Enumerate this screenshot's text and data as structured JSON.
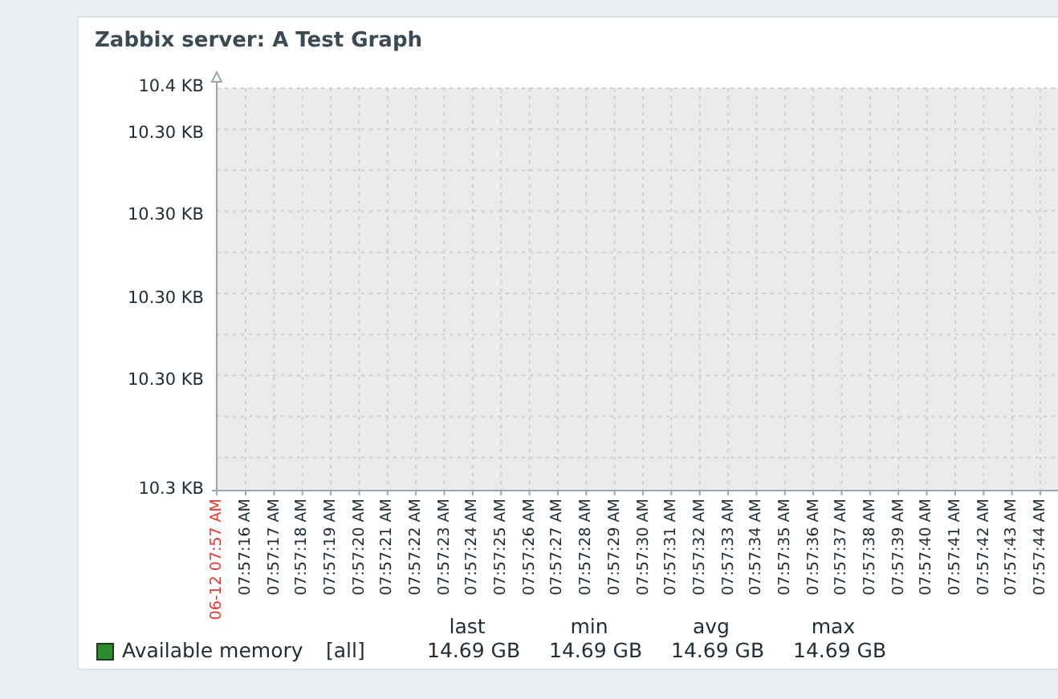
{
  "title": "Zabbix server: A Test Graph",
  "y_labels": [
    "10.4 KB",
    "10.30 KB",
    "10.30 KB",
    "10.30 KB",
    "10.30 KB",
    "10.3 KB"
  ],
  "x_labels": [
    {
      "text": "06-12 07:57 AM",
      "kind": "date"
    },
    {
      "text": "07:57:16 AM",
      "kind": "time"
    },
    {
      "text": "07:57:17 AM",
      "kind": "time"
    },
    {
      "text": "07:57:18 AM",
      "kind": "time"
    },
    {
      "text": "07:57:19 AM",
      "kind": "time"
    },
    {
      "text": "07:57:20 AM",
      "kind": "time"
    },
    {
      "text": "07:57:21 AM",
      "kind": "time"
    },
    {
      "text": "07:57:22 AM",
      "kind": "time"
    },
    {
      "text": "07:57:23 AM",
      "kind": "time"
    },
    {
      "text": "07:57:24 AM",
      "kind": "time"
    },
    {
      "text": "07:57:25 AM",
      "kind": "time"
    },
    {
      "text": "07:57:26 AM",
      "kind": "time"
    },
    {
      "text": "07:57:27 AM",
      "kind": "time"
    },
    {
      "text": "07:57:28 AM",
      "kind": "time"
    },
    {
      "text": "07:57:29 AM",
      "kind": "time"
    },
    {
      "text": "07:57:30 AM",
      "kind": "time"
    },
    {
      "text": "07:57:31 AM",
      "kind": "time"
    },
    {
      "text": "07:57:32 AM",
      "kind": "time"
    },
    {
      "text": "07:57:33 AM",
      "kind": "time"
    },
    {
      "text": "07:57:34 AM",
      "kind": "time"
    },
    {
      "text": "07:57:35 AM",
      "kind": "time"
    },
    {
      "text": "07:57:36 AM",
      "kind": "time"
    },
    {
      "text": "07:57:37 AM",
      "kind": "time"
    },
    {
      "text": "07:57:38 AM",
      "kind": "time"
    },
    {
      "text": "07:57:39 AM",
      "kind": "time"
    },
    {
      "text": "07:57:40 AM",
      "kind": "time"
    },
    {
      "text": "07:57:41 AM",
      "kind": "time"
    },
    {
      "text": "07:57:42 AM",
      "kind": "time"
    },
    {
      "text": "07:57:43 AM",
      "kind": "time"
    },
    {
      "text": "07:57:44 AM",
      "kind": "time"
    }
  ],
  "legend": {
    "columns": [
      "last",
      "min",
      "avg",
      "max"
    ],
    "items": [
      {
        "name": "Available memory",
        "color": "#2e8b2e",
        "function": "[all]",
        "values": [
          "14.69 GB",
          "14.69 GB",
          "14.69 GB",
          "14.69 GB"
        ]
      }
    ]
  }
}
